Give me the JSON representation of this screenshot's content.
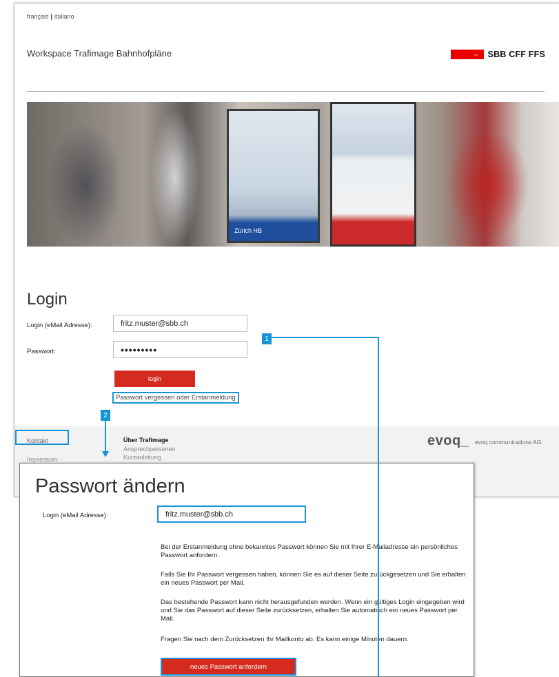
{
  "header": {
    "lang_links": [
      "français",
      "italiano"
    ],
    "lang_separator": "|",
    "site_title": "Workspace Trafimage Bahnhofpläne",
    "logo_text": "SBB CFF FFS",
    "logo_glyph": "⇔"
  },
  "hero": {
    "panel_caption": "Zürich HB"
  },
  "login": {
    "heading": "Login",
    "email_label": "Login (eMail Adresse):",
    "email_value": "fritz.muster@sbb.ch",
    "password_label": "Passwort:",
    "password_value": "•••••••••",
    "submit_label": "login",
    "forgot_link": "Passwort vergessen oder Erstanmeldung"
  },
  "footer": {
    "kontakt": "Kontakt",
    "impressum": "Impressum",
    "ueber_heading": "Über Trafimage",
    "ansprechpersonen": "Ansprechpersonen",
    "kurzanleitung": "Kurzanleitung",
    "company_mark": "evoq_",
    "company_name": "evoq communications AG"
  },
  "annotations": {
    "step1": "1",
    "step2": "2",
    "accent_color": "#1693d6"
  },
  "dialog": {
    "title": "Passwort ändern",
    "email_label": "Login (eMail Adresse):",
    "email_value": "fritz.muster@sbb.ch",
    "paragraphs": [
      "Bei der Erstanmeldung ohne bekanntes Passwort können Sie mit Ihrer E-Mailadresse ein persönliches Passwort anfordern.",
      "Falls Sie Ihr Passwort vergessen haben, können Sie es auf dieser Seite zurückgesetzen und Sie erhalten ein neues Passwort per Mail.",
      "Das bestehende Passwort kann nicht herausgefunden werden. Wenn ein gültiges Login eingegeben wird und Sie das Passwort auf dieser Seite zurücksetzen, erhalten Sie automatisch ein neues Passwort per Mail.",
      "Fragen Sie nach dem Zurücksetzen Ihr Mailkonto ab. Es kann einige Minuten dauern."
    ],
    "submit_label": "neues Passwort anfordern"
  },
  "colors": {
    "sbb_red": "#eb0000",
    "button_red": "#d52b1e"
  }
}
